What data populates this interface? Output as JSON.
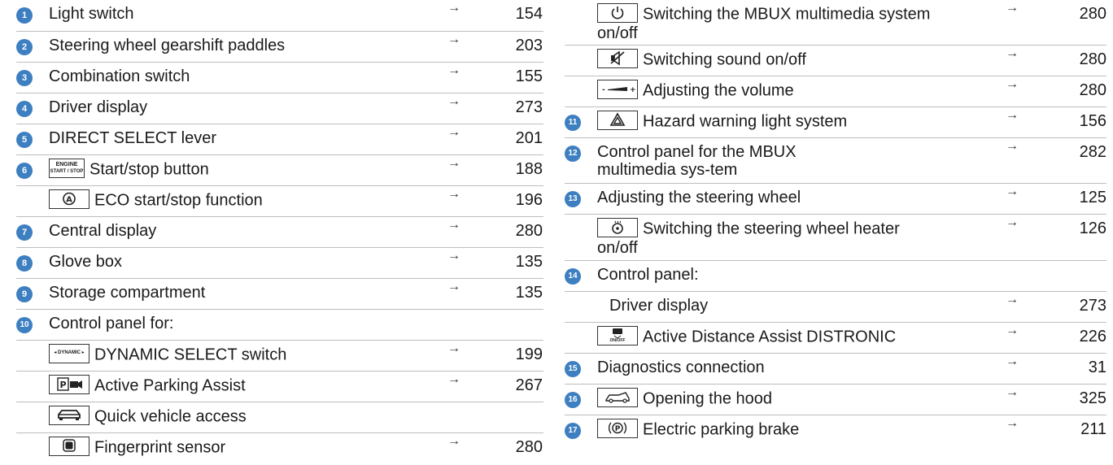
{
  "left": [
    {
      "num": "1",
      "label": "Light switch",
      "page": "154"
    },
    {
      "num": "2",
      "label": "Steering wheel gearshift paddles",
      "page": "203"
    },
    {
      "num": "3",
      "label": "Combination switch",
      "page": "155"
    },
    {
      "num": "4",
      "label": "Driver display",
      "page": "273"
    },
    {
      "num": "5",
      "label": "DIRECT SELECT lever",
      "page": "201"
    },
    {
      "num": "6",
      "label": "Start/stop button",
      "page": "188",
      "key": "ENGINE START / STOP"
    },
    {
      "label": "ECO start/stop function",
      "page": "196",
      "key": "eco-icon"
    },
    {
      "num": "7",
      "label": "Central display",
      "page": "280"
    },
    {
      "num": "8",
      "label": "Glove box",
      "page": "135"
    },
    {
      "num": "9",
      "label": "Storage compartment",
      "page": "135"
    },
    {
      "num": "10",
      "label": "Control panel for:"
    },
    {
      "label": "DYNAMIC SELECT switch",
      "page": "199",
      "key": "DYNAMIC"
    },
    {
      "label": "Active Parking Assist",
      "page": "267",
      "key": "parking-camera-icon"
    },
    {
      "label": "Quick vehicle access",
      "key": "car-icon"
    },
    {
      "label": "Fingerprint sensor",
      "page": "280",
      "key": "fingerprint-icon"
    }
  ],
  "right": [
    {
      "label": "Switching the MBUX multimedia system on/off",
      "page": "280",
      "key": "power-icon"
    },
    {
      "label": "Switching sound on/off",
      "page": "280",
      "key": "mute-icon"
    },
    {
      "label": "Adjusting the volume",
      "page": "280",
      "key": "volume-slider-icon"
    },
    {
      "num": "11",
      "label": "Hazard warning light system",
      "page": "156",
      "key": "hazard-icon"
    },
    {
      "num": "12",
      "label": "Control panel for the MBUX multimedia sys-tem",
      "page": "282"
    },
    {
      "num": "13",
      "label": "Adjusting the steering wheel",
      "page": "125"
    },
    {
      "label": "Switching the steering wheel heater on/off",
      "page": "126",
      "key": "steering-heater-icon"
    },
    {
      "num": "14",
      "label": "Control panel:"
    },
    {
      "label": "Driver display",
      "page": "273"
    },
    {
      "label": "Active Distance Assist DISTRONIC",
      "page": "226",
      "key": "distronic-icon"
    },
    {
      "num": "15",
      "label": "Diagnostics connection",
      "page": "31"
    },
    {
      "num": "16",
      "label": "Opening the hood",
      "page": "325",
      "key": "hood-icon"
    },
    {
      "num": "17",
      "label": "Electric parking brake",
      "page": "211",
      "key": "parking-brake-icon"
    }
  ],
  "arrow": "→",
  "keys": {
    "engine_line1": "ENGINE",
    "engine_line2": "START / STOP",
    "dynamic": "DYNAMIC",
    "distronic_sub": "ON/OFF"
  },
  "colors": {
    "badge": "#3d7fc1",
    "rule": "#bdbdbd"
  }
}
